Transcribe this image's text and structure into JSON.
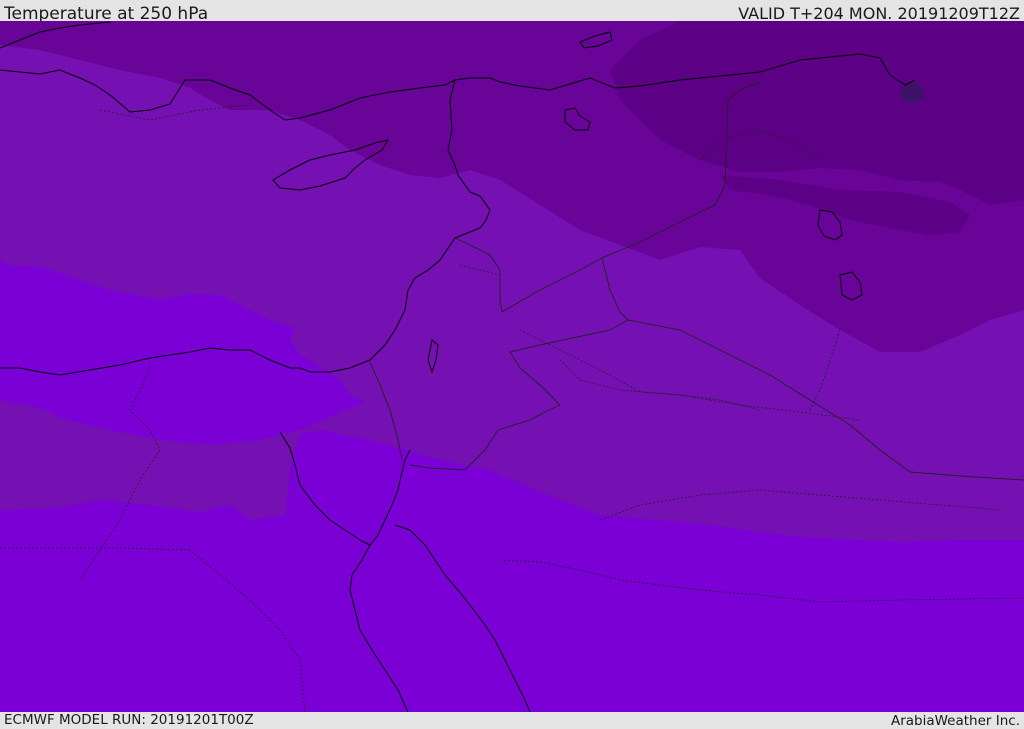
{
  "header": {
    "title": "Temperature at 250 hPa",
    "valid": "VALID T+204 MON. 20191209T12Z"
  },
  "footer": {
    "model_run": "ECMWF MODEL RUN: 20191201T00Z",
    "credit": "ArabiaWeather Inc."
  },
  "colors": {
    "band_warmest": "#7b00d6",
    "band_mid": "#7510b3",
    "band_cool": "#680497",
    "band_colder": "#5c0085",
    "band_coldest": "#3b1266",
    "coast": "#000000",
    "border": "#222222"
  }
}
